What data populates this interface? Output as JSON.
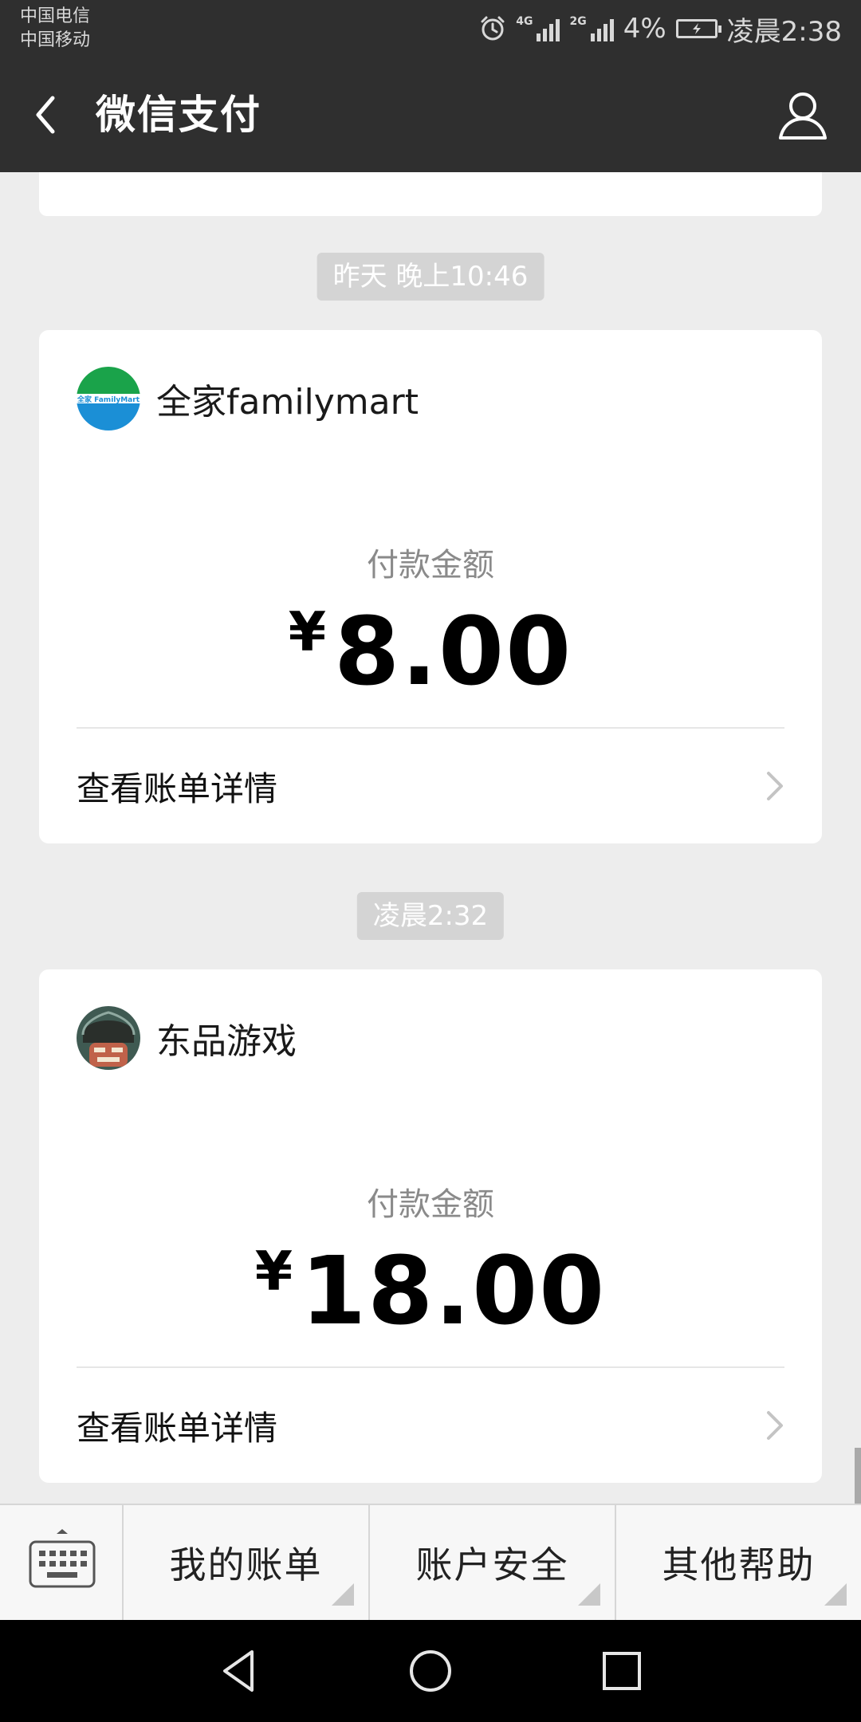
{
  "status_bar": {
    "carrier_1": "中国电信",
    "carrier_2": "中国移动",
    "net_1": "4G",
    "net_2": "2G",
    "battery_percent": "4%",
    "time": "凌晨2:38"
  },
  "nav": {
    "title": "微信支付"
  },
  "messages": [
    {
      "time": "昨天 晚上10:46",
      "merchant": "全家familymart",
      "logo_text": "全家 FamilyMart",
      "amount_label": "付款金额",
      "currency": "¥",
      "amount": "8.00",
      "detail_label": "查看账单详情"
    },
    {
      "time": "凌晨2:32",
      "merchant": "东品游戏",
      "amount_label": "付款金额",
      "currency": "¥",
      "amount": "18.00",
      "detail_label": "查看账单详情"
    }
  ],
  "menu": {
    "items": [
      "我的账单",
      "账户安全",
      "其他帮助"
    ]
  },
  "colors": {
    "header_bg": "#2f2f2f",
    "page_bg": "#ededed",
    "chip_bg": "#d4d4d4",
    "familymart_green": "#1aa34a",
    "familymart_blue": "#1b8fd6"
  }
}
